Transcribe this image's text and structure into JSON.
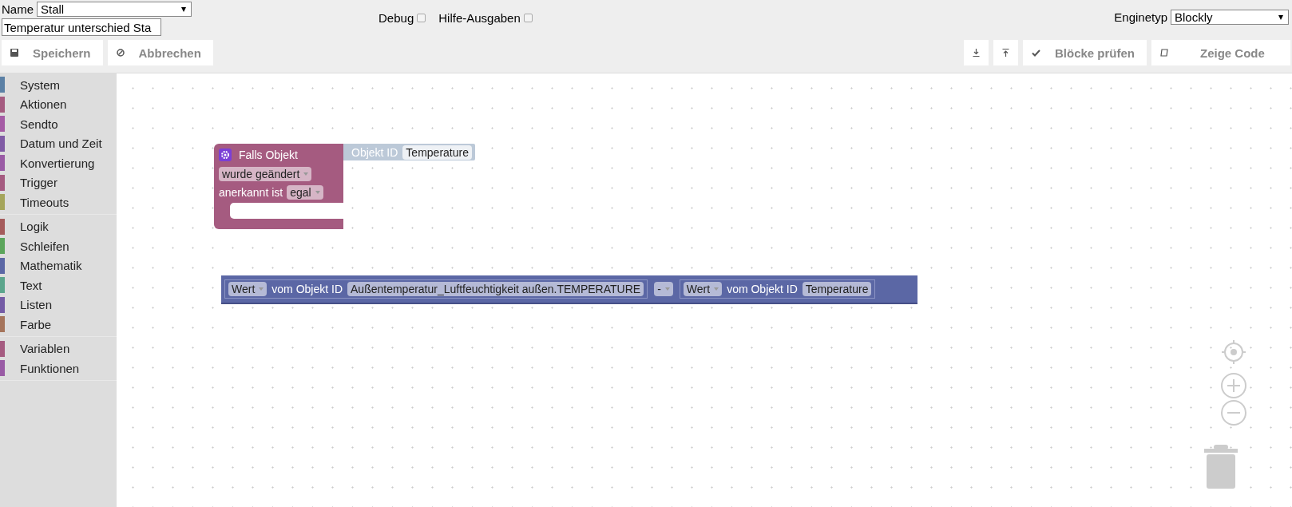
{
  "header": {
    "name_label": "Name",
    "name_value": "Stall",
    "description": "Temperatur unterschied Sta",
    "debug": {
      "label": "Debug",
      "checked": false
    },
    "help": {
      "label": "Hilfe-Ausgaben",
      "checked": false
    },
    "engine_label": "Enginetyp",
    "engine_value": "Blockly"
  },
  "toolbar": {
    "left": [
      {
        "kind": "save",
        "label": "Speichern"
      },
      {
        "kind": "cancel",
        "label": "Abbrechen"
      }
    ],
    "right": [
      {
        "kind": "export"
      },
      {
        "kind": "import"
      },
      {
        "kind": "check",
        "label": "Blöcke prüfen"
      },
      {
        "kind": "code",
        "label": "Zeige Code"
      }
    ]
  },
  "sidebar": {
    "groups": [
      {
        "items": [
          {
            "label": "System",
            "color": "#5b80a5"
          },
          {
            "label": "Aktionen",
            "color": "#a55b80"
          },
          {
            "label": "Sendto",
            "color": "#a55ba5"
          },
          {
            "label": "Datum und Zeit",
            "color": "#805ba5"
          },
          {
            "label": "Konvertierung",
            "color": "#9a5ba5"
          },
          {
            "label": "Trigger",
            "color": "#a55b80"
          },
          {
            "label": "Timeouts",
            "color": "#a5a55b"
          }
        ]
      },
      {
        "items": [
          {
            "label": "Logik",
            "color": "#a55b5b"
          },
          {
            "label": "Schleifen",
            "color": "#5ba55b"
          },
          {
            "label": "Mathematik",
            "color": "#5b67a5"
          },
          {
            "label": "Text",
            "color": "#5ba58c"
          },
          {
            "label": "Listen",
            "color": "#745ba5"
          },
          {
            "label": "Farbe",
            "color": "#a5745b"
          }
        ]
      },
      {
        "items": [
          {
            "label": "Variablen",
            "color": "#a55b80"
          },
          {
            "label": "Funktionen",
            "color": "#995ba5"
          }
        ]
      }
    ]
  },
  "workspace": {
    "blocks": [
      {
        "kind": "event",
        "title": "Falls Objekt",
        "input_label": "Objekt ID",
        "input_value": "Temperature",
        "trigger": "wurde geändert",
        "ack_label": "anerkannt ist",
        "ack_value": "egal"
      },
      {
        "kind": "math",
        "left": {
          "dropdown": "Wert",
          "label": "vom Objekt ID",
          "value": "Außentemperatur_Luftfeuchtigkeit außen.TEMPERATURE"
        },
        "operator": "-",
        "right": {
          "dropdown": "Wert",
          "label": "vom Objekt ID",
          "value": "Temperature"
        }
      }
    ]
  }
}
